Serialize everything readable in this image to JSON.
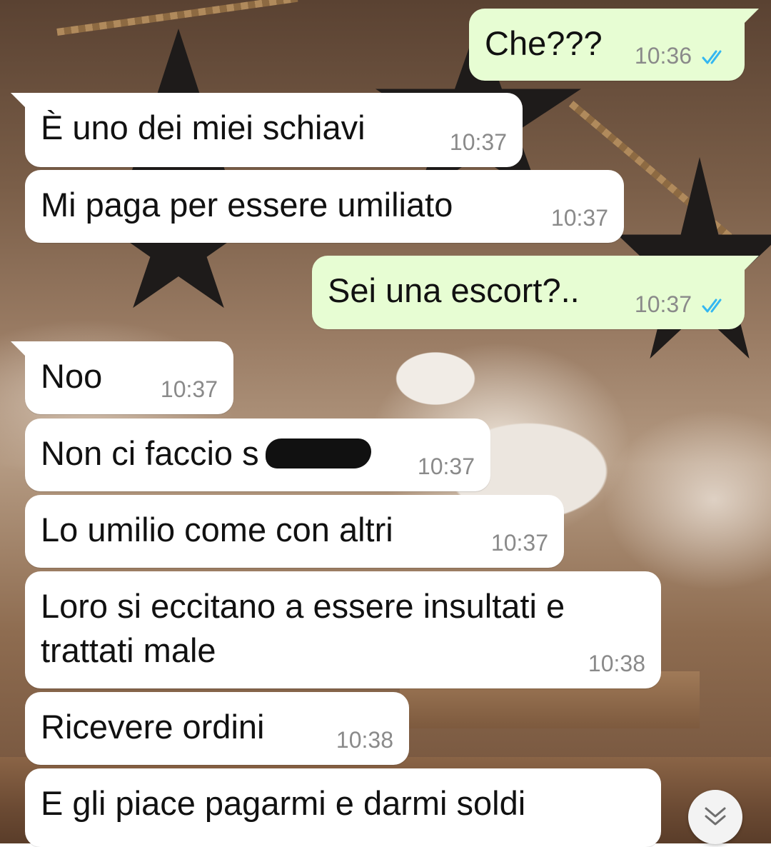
{
  "theme": {
    "incoming_bubble": "#ffffff",
    "outgoing_bubble": "#e7fdd3",
    "timestamp_color": "#8a8a8a",
    "read_ticks_color": "#34b7f1"
  },
  "messages": [
    {
      "direction": "outgoing",
      "text": "Che???",
      "time": "10:36",
      "status": "read"
    },
    {
      "direction": "incoming",
      "text": "È uno dei miei schiavi",
      "time": "10:37"
    },
    {
      "direction": "incoming",
      "text": "Mi paga per essere umiliato",
      "time": "10:37"
    },
    {
      "direction": "outgoing",
      "text": "Sei una escort?..",
      "time": "10:37",
      "status": "read"
    },
    {
      "direction": "incoming",
      "text": "Noo",
      "time": "10:37"
    },
    {
      "direction": "incoming",
      "text": "Non ci faccio s",
      "time": "10:37",
      "redacted": true
    },
    {
      "direction": "incoming",
      "text": "Lo umilio come con altri",
      "time": "10:37"
    },
    {
      "direction": "incoming",
      "lines": [
        "Loro si eccitano a essere insultati e",
        "trattati male"
      ],
      "time": "10:38"
    },
    {
      "direction": "incoming",
      "text": "Ricevere ordini",
      "time": "10:38"
    },
    {
      "direction": "incoming",
      "text": "E gli piace pagarmi e darmi soldi",
      "time": null
    }
  ],
  "scroll_button": {
    "icon": "double-chevron-down-icon"
  }
}
